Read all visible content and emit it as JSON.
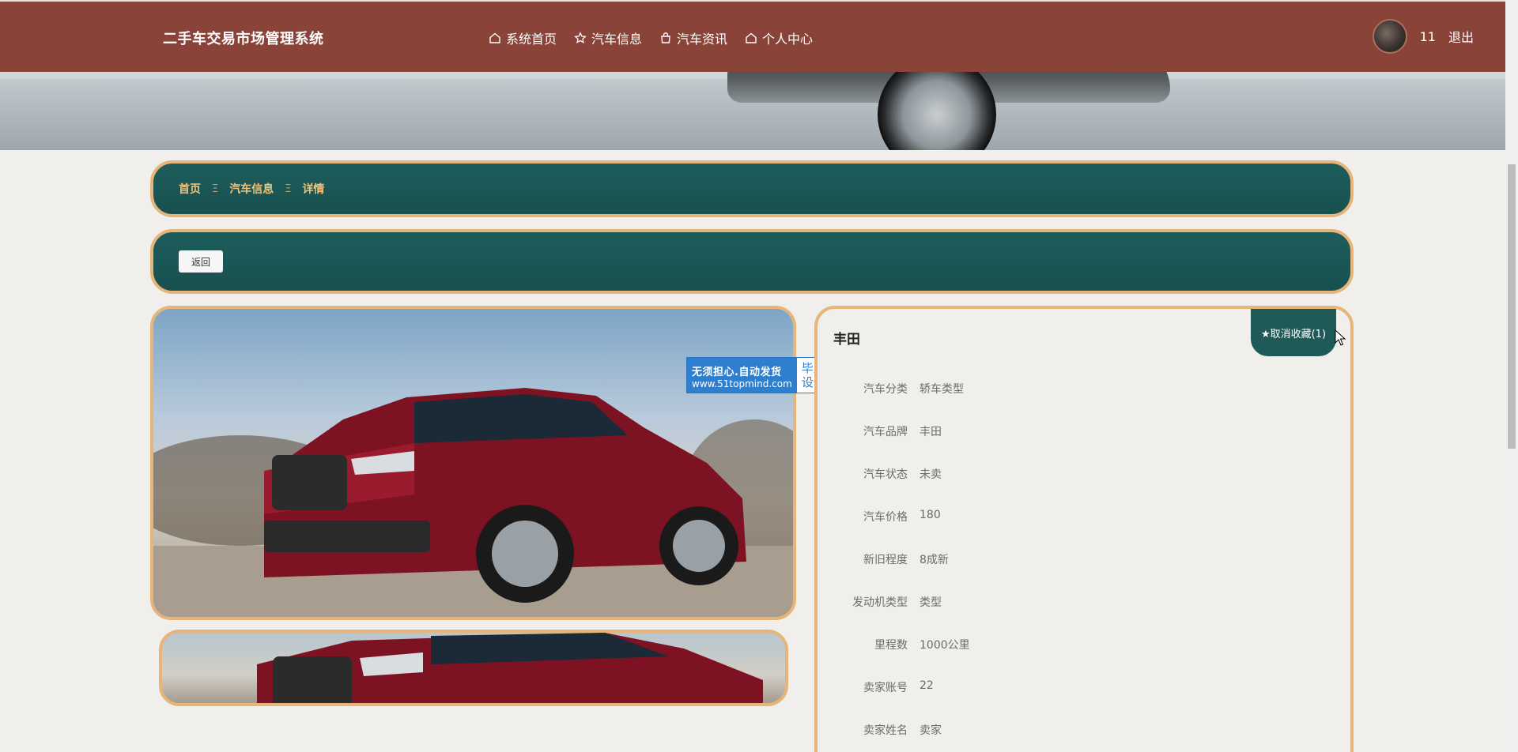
{
  "nav": {
    "brand": "二手车交易市场管理系统",
    "links": [
      {
        "label": "系统首页",
        "icon": "home-icon"
      },
      {
        "label": "汽车信息",
        "icon": "star-icon"
      },
      {
        "label": "汽车资讯",
        "icon": "bag-icon"
      },
      {
        "label": "个人中心",
        "icon": "home-icon"
      }
    ],
    "username": "11",
    "logout": "退出"
  },
  "breadcrumb": {
    "items": [
      "首页",
      "汽车信息",
      "详情"
    ],
    "separator": "Ξ"
  },
  "actions": {
    "back_label": "返回"
  },
  "watermark": {
    "line1": "无须担心.自动发货",
    "line2": "www.51topmind.com",
    "right1": "毕业",
    "right2": "设计"
  },
  "detail": {
    "title": "丰田",
    "favorite_label": "★取消收藏(1)",
    "fields": [
      {
        "label": "汽车分类",
        "value": "轿车类型"
      },
      {
        "label": "汽车品牌",
        "value": "丰田"
      },
      {
        "label": "汽车状态",
        "value": "未卖"
      },
      {
        "label": "汽车价格",
        "value": "180"
      },
      {
        "label": "新旧程度",
        "value": "8成新"
      },
      {
        "label": "发动机类型",
        "value": "类型"
      },
      {
        "label": "里程数",
        "value": "1000公里"
      },
      {
        "label": "卖家账号",
        "value": "22"
      },
      {
        "label": "卖家姓名",
        "value": "卖家"
      }
    ]
  },
  "colors": {
    "nav_bg": "#8a4338",
    "teal": "#1e5d5c",
    "border_gold": "#e7b57a",
    "crumb_gold": "#f0c27b"
  }
}
